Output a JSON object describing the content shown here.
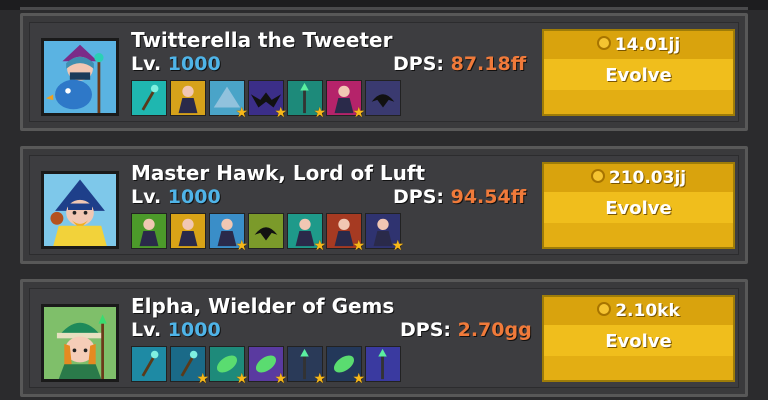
{
  "heroes": [
    {
      "name": "Twitterella the Tweeter",
      "lv_label": "Lv.",
      "level": "1000",
      "dps_label": "DPS:",
      "dps": "87.18ff",
      "cost": "14.01jj",
      "evolve_label": "Evolve",
      "skills": [
        {
          "icon": "staff-icon",
          "bg": "#1fb7b0",
          "star": false
        },
        {
          "icon": "bird-rider-icon",
          "bg": "#d6a21a",
          "star": false
        },
        {
          "icon": "wing-icon",
          "bg": "#4aa4c8",
          "star": true
        },
        {
          "icon": "bat-icon",
          "bg": "#3b2e88",
          "star": true
        },
        {
          "icon": "gem-staff-icon",
          "bg": "#1d8a7a",
          "star": true
        },
        {
          "icon": "witch-icon",
          "bg": "#b5236a",
          "star": true
        },
        {
          "icon": "raven-icon",
          "bg": "#3a3a70",
          "star": false
        }
      ]
    },
    {
      "name": "Master Hawk, Lord of Luft",
      "lv_label": "Lv.",
      "level": "1000",
      "dps_label": "DPS:",
      "dps": "94.54ff",
      "cost": "210.03jj",
      "evolve_label": "Evolve",
      "skills": [
        {
          "icon": "goblin-icon",
          "bg": "#4c9a2a",
          "star": false
        },
        {
          "icon": "duck-icon",
          "bg": "#d8a317",
          "star": false
        },
        {
          "icon": "knight-icon",
          "bg": "#3a8ec8",
          "star": true
        },
        {
          "icon": "hawk-icon",
          "bg": "#7b9a2a",
          "star": false
        },
        {
          "icon": "ninja-icon",
          "bg": "#1e9a8a",
          "star": true
        },
        {
          "icon": "imp-icon",
          "bg": "#a63a22",
          "star": true
        },
        {
          "icon": "wizard-icon",
          "bg": "#2f3370",
          "star": true
        }
      ]
    },
    {
      "name": "Elpha, Wielder of Gems",
      "lv_label": "Lv.",
      "level": "1000",
      "dps_label": "DPS:",
      "dps": "2.70gg",
      "cost": "2.10kk",
      "evolve_label": "Evolve",
      "skills": [
        {
          "icon": "emerald-staff-icon",
          "bg": "#1e8aa4",
          "star": false
        },
        {
          "icon": "leaf-sword-icon",
          "bg": "#1a6a88",
          "star": true
        },
        {
          "icon": "ring-icon",
          "bg": "#1e8a7a",
          "star": true
        },
        {
          "icon": "leaf-icon",
          "bg": "#5a3aa0",
          "star": true
        },
        {
          "icon": "forest-icon",
          "bg": "#2a3a58",
          "star": true
        },
        {
          "icon": "night-leaf-icon",
          "bg": "#23385a",
          "star": true
        },
        {
          "icon": "crystal-wand-icon",
          "bg": "#3a3aa0",
          "star": false
        }
      ]
    }
  ]
}
